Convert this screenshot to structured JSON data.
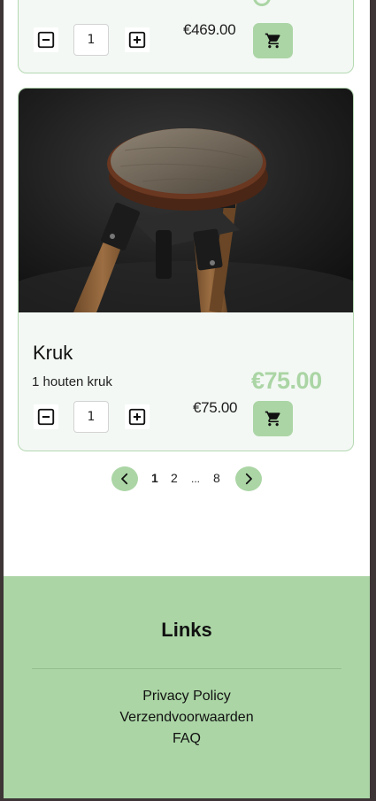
{
  "products": [
    {
      "price": "€469.00",
      "quantity": "1",
      "image_alt": ""
    },
    {
      "title": "Kruk",
      "description": "1 houten kruk",
      "big_price": "€75.00",
      "price": "€75.00",
      "quantity": "1"
    }
  ],
  "pagination": {
    "pages": [
      "1",
      "2",
      "...",
      "8"
    ],
    "current": "1"
  },
  "footer": {
    "heading": "Links",
    "links": [
      "Privacy Policy",
      "Verzendvoorwaarden",
      "FAQ"
    ]
  },
  "colors": {
    "accent": "#abd5a5",
    "card_bg": "#f3f8f4",
    "card_border": "#b5d9b2"
  }
}
